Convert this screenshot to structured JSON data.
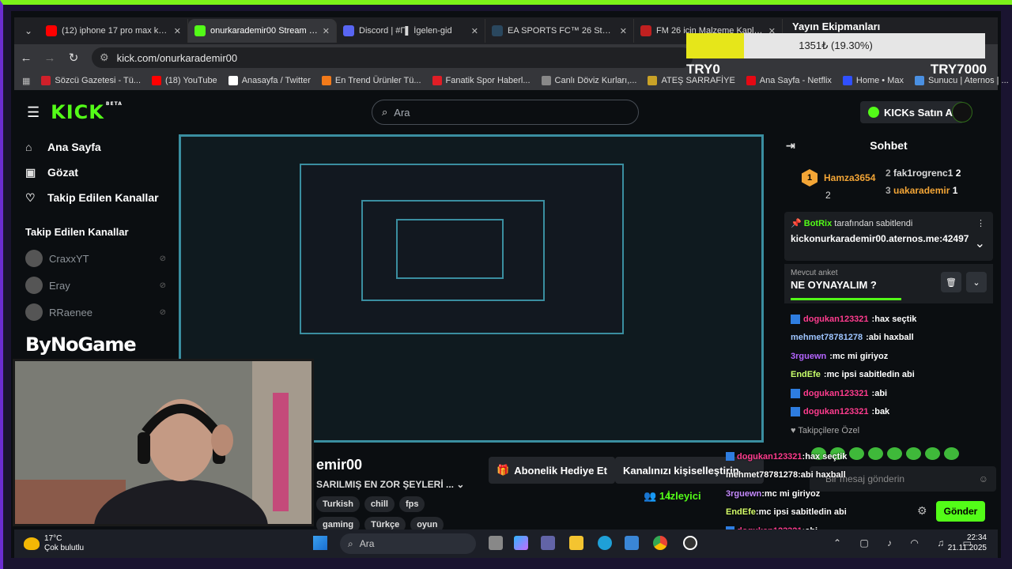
{
  "tabs": [
    {
      "title": "(12) iphone 17 pro max kaç gü",
      "color": "#ff0000"
    },
    {
      "title": "onurkarademir00 Stream - Wat",
      "color": "#53fc18"
    },
    {
      "title": "Discord | #Γ▌ İgelen-gid",
      "color": "#5865f2"
    },
    {
      "title": "EA SPORTS FC™ 26 Steam'de %",
      "color": "#2a475e"
    },
    {
      "title": "FM 26 için Malzeme Kaplaması",
      "color": "#c02020"
    }
  ],
  "url": "kick.com/onurkarademir00",
  "bookmarks": [
    {
      "label": "Sözcü Gazetesi - Tü...",
      "color": "#d0202a"
    },
    {
      "label": "(18) YouTube",
      "color": "#ff0000"
    },
    {
      "label": "Anasayfa / Twitter",
      "color": "#ffffff"
    },
    {
      "label": "En Trend Ürünler Tü...",
      "color": "#f27a1a"
    },
    {
      "label": "Fanatik Spor Haberl...",
      "color": "#e01e26"
    },
    {
      "label": "Canlı Döviz Kurları,...",
      "color": "#888888"
    },
    {
      "label": "ATEŞ SARRAFİYE",
      "color": "#c9a227"
    },
    {
      "label": "Ana Sayfa - Netflix",
      "color": "#e50914"
    },
    {
      "label": "Home • Max",
      "color": "#3050ff"
    },
    {
      "label": "Sunucu | Aternos | ...",
      "color": "#4a90e2"
    }
  ],
  "equipment": {
    "title": "Yayın Ekipmanları",
    "progress_text": "1351₺ (19.30%)",
    "progress": 0.193,
    "min": "TRY0",
    "max": "TRY7000"
  },
  "kick": {
    "logo": "KICK",
    "beta": "BETA",
    "search_placeholder": "Ara",
    "kicks_button": "KICKs Satın Al",
    "nav": [
      {
        "label": "Ana Sayfa",
        "icon": "home-icon"
      },
      {
        "label": "Gözat",
        "icon": "browse-icon"
      },
      {
        "label": "Takip Edilen Kanallar",
        "icon": "heart-icon"
      }
    ],
    "followed_heading": "Takip Edilen Kanallar",
    "channels": [
      "CraxxYT",
      "Eray",
      "RRaenee"
    ],
    "sponsor": "ByNoGame"
  },
  "stream": {
    "channel": "emir00",
    "title": "SARILMIŞ EN ZOR ŞEYLERİ ...",
    "tags": [
      "Turkish",
      "chill",
      "fps",
      "gaming",
      "Türkçe",
      "oyun"
    ],
    "sub_button": "Abonelik Hediye Et",
    "customize_button": "Kanalınızı kişiselleştirin",
    "viewers": "14",
    "viewers_label": "İzleyici"
  },
  "chat": {
    "title": "Sohbet",
    "leader_main": {
      "rank": "1",
      "name": "Hamza3654",
      "count": "2"
    },
    "leaders": [
      {
        "rank": "2",
        "name": "fak1rogrenc1",
        "count": "2",
        "color": "#dddddd"
      },
      {
        "rank": "3",
        "name": "uakarademir",
        "count": "1",
        "color": "#f3a536"
      }
    ],
    "pinned_by": "BotRix",
    "pinned_suffix": "tarafından sabitlendi",
    "pinned_message": "kickonurkarademir00.aternos.me:42497",
    "poll_label": "Mevcut anket",
    "poll_question": "NE OYNAYALIM ?",
    "messages": [
      {
        "user": "dogukan123321",
        "text": "hax seçtik",
        "color": "#ff3c8e",
        "badge": true
      },
      {
        "user": "mehmet78781278",
        "text": "abi haxball",
        "color": "#9ec5ff",
        "badge": false
      },
      {
        "user": "3rguewn",
        "text": "mc mi giriyoz",
        "color": "#b565ff",
        "badge": false
      },
      {
        "user": "EndEfe",
        "text": "mc ipsi sabitledin abi",
        "color": "#c8ff6a",
        "badge": false
      },
      {
        "user": "dogukan123321",
        "text": "abi",
        "color": "#ff3c8e",
        "badge": true
      },
      {
        "user": "dogukan123321",
        "text": "bak",
        "color": "#ff3c8e",
        "badge": true
      }
    ],
    "followers_only": "Takipçilere Özel",
    "input_placeholder": "Bir mesaj gönderin",
    "send": "Gönder"
  },
  "overlay_chat": [
    {
      "user": "dogukan123321",
      "text": "hax seçtik",
      "color": "#ff3c8e",
      "badge": true
    },
    {
      "user": "mehmet78781278",
      "text": "abi haxball",
      "color": "#ffffff",
      "badge": false
    },
    {
      "user": "3rguewn",
      "text": "mc mi giriyoz",
      "color": "#c58bff",
      "badge": false
    },
    {
      "user": "EndEfe",
      "text": "mc ipsi sabitledin abi",
      "color": "#d6ff6a",
      "badge": false
    },
    {
      "user": "dogukan123321",
      "text": "abi",
      "color": "#ff3c8e",
      "badge": true
    },
    {
      "user": "dogukan123321",
      "text": "bak",
      "color": "#ff3c8e",
      "badge": true
    }
  ],
  "taskbar": {
    "temp": "17°C",
    "weather": "Çok bulutlu",
    "search": "Ara",
    "time": "22:34",
    "date": "21.11.2025"
  }
}
